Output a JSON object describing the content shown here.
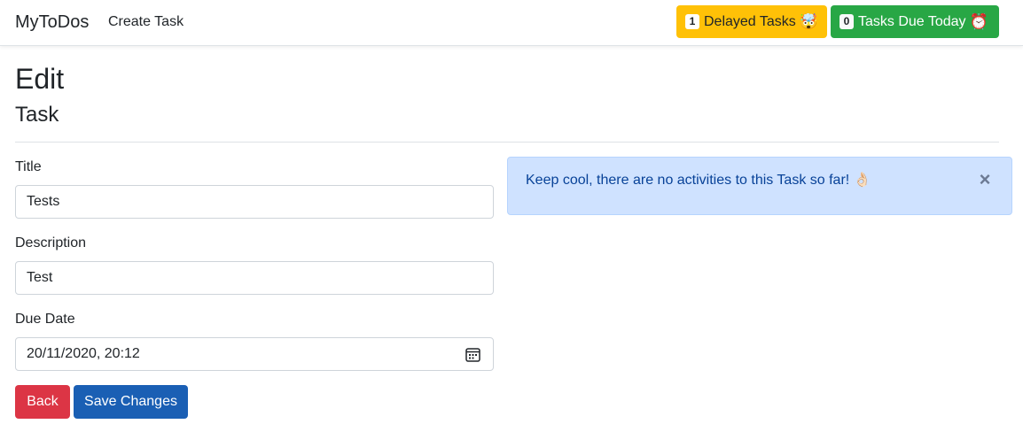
{
  "navbar": {
    "brand": "MyToDos",
    "create_link": "Create Task",
    "delayed": {
      "count": "1",
      "label": "Delayed Tasks",
      "emoji": "🤯"
    },
    "due_today": {
      "count": "0",
      "label": "Tasks Due Today",
      "emoji": "⏰"
    }
  },
  "page": {
    "title": "Edit",
    "subtitle": "Task"
  },
  "form": {
    "title_label": "Title",
    "title_value": "Tests",
    "description_label": "Description",
    "description_value": "Test",
    "due_date_label": "Due Date",
    "due_date_value": "20/11/2020, 20:12",
    "back_label": "Back",
    "save_label": "Save Changes"
  },
  "alert": {
    "message": "Keep cool, there are no activities to this Task so far! 👌🏻",
    "close_symbol": "×"
  },
  "colors": {
    "warning": "#ffc107",
    "success": "#28a745",
    "danger": "#dc3545",
    "primary": "#1a5fb4",
    "alert_bg": "#cfe2ff"
  }
}
